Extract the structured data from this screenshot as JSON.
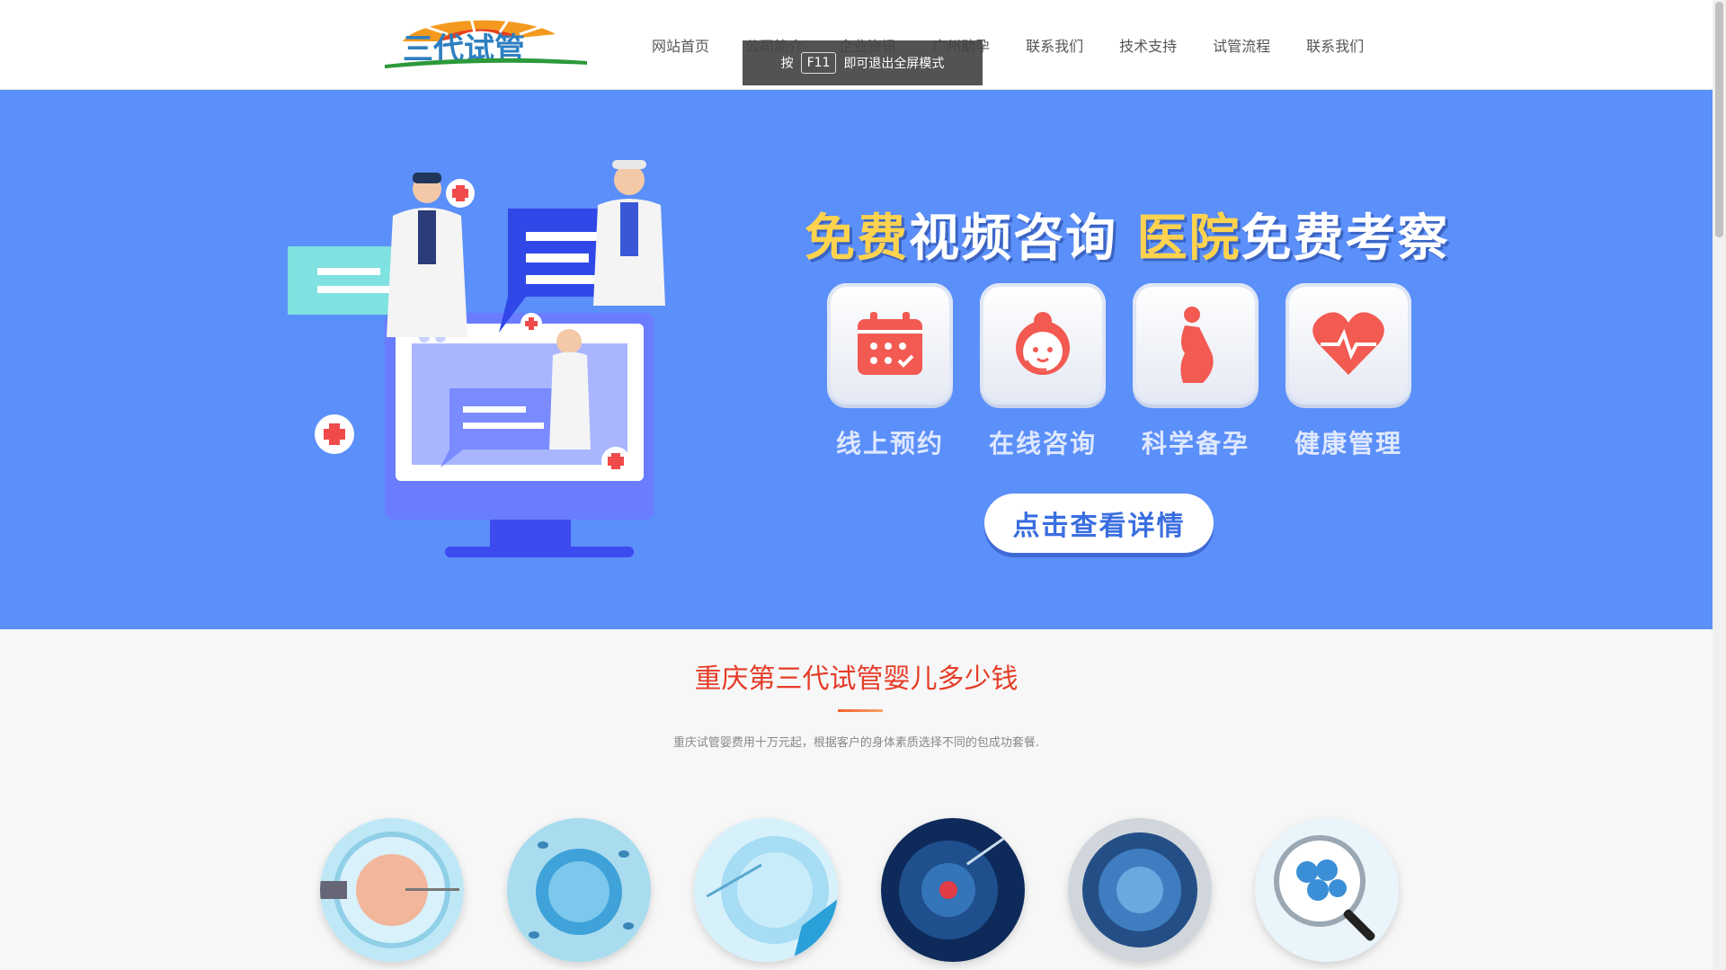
{
  "header": {
    "logo_text": "三代试管",
    "nav": [
      "网站首页",
      "公司简介",
      "企业资讯",
      "广州助孕",
      "联系我们",
      "技术支持",
      "试管流程",
      "联系我们"
    ]
  },
  "toast": {
    "prefix": "按",
    "key": "F11",
    "suffix": "即可退出全屏模式"
  },
  "banner": {
    "headline_part1": "免费",
    "headline_part2": "视频咨询",
    "headline_part3": "医院",
    "headline_part4": "免费考察",
    "services": [
      {
        "label": "线上预约",
        "icon": "calendar-icon"
      },
      {
        "label": "在线咨询",
        "icon": "support-agent-icon"
      },
      {
        "label": "科学备孕",
        "icon": "pregnant-woman-icon"
      },
      {
        "label": "健康管理",
        "icon": "heart-pulse-icon"
      }
    ],
    "detail_button": "点击查看详情"
  },
  "section": {
    "title": "重庆第三代试管婴儿多少钱",
    "description": "重庆试管婴费用十万元起，根据客户的身体素质选择不同的包成功套餐."
  },
  "colors": {
    "banner_bg": "#5b8ff9",
    "title_red": "#e53c27",
    "accent_yellow": "#ffd34e",
    "icon_red": "#f25a52"
  }
}
